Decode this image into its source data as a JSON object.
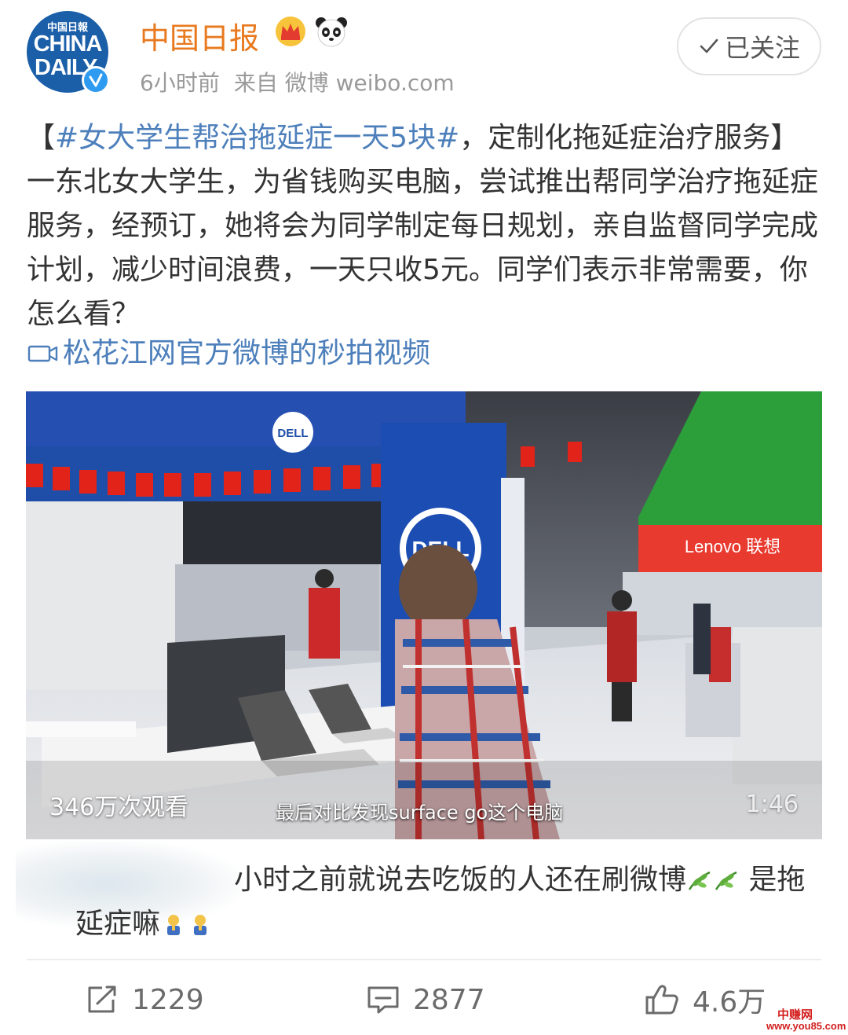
{
  "header": {
    "avatar": {
      "cn_text": "中国日報",
      "logo_line1": "CHINA",
      "logo_line2": "DAILY"
    },
    "user_name": "中国日报",
    "time": "6小时前",
    "source": "来自 微博 weibo.com",
    "follow_label": "已关注",
    "badges": [
      "crown-icon",
      "panda-icon",
      "verified-icon"
    ]
  },
  "post": {
    "bracket_open": "【",
    "hashtag": "#女大学生帮治拖延症一天5块#",
    "text": "，定制化拖延症治疗服务】一东北女大学生，为省钱购买电脑，尝试推出帮同学治疗拖延症服务，经预订，她将会为同学制定每日规划，亲自监督同学完成计划，减少时间浪费，一天只收5元。同学们表示非常需要，你怎么看？",
    "video_link": "松花江网官方微博的秒拍视频"
  },
  "video": {
    "views": "346万次观看",
    "subtitle": "最后对比发现surface go这个电脑",
    "duration": "1:46",
    "store_signs": [
      "DELL",
      "DELL",
      "Lenovo 联想"
    ]
  },
  "comment": {
    "text": "小时之前就说去吃饭的人还在刷微博",
    "text2": " 是拖延症嘛",
    "emojis": [
      "leaf-icon",
      "leaf-icon",
      "prayer-icon",
      "prayer-icon"
    ]
  },
  "actions": {
    "repost_count": "1229",
    "comment_count": "2877",
    "like_count": "4.6万"
  },
  "watermark": {
    "line1": "中赚网",
    "line2": "www.you85.com"
  },
  "colors": {
    "name": "#e8791e",
    "link": "#4d7fbb",
    "text": "#333333",
    "meta": "#9a9a9a"
  }
}
